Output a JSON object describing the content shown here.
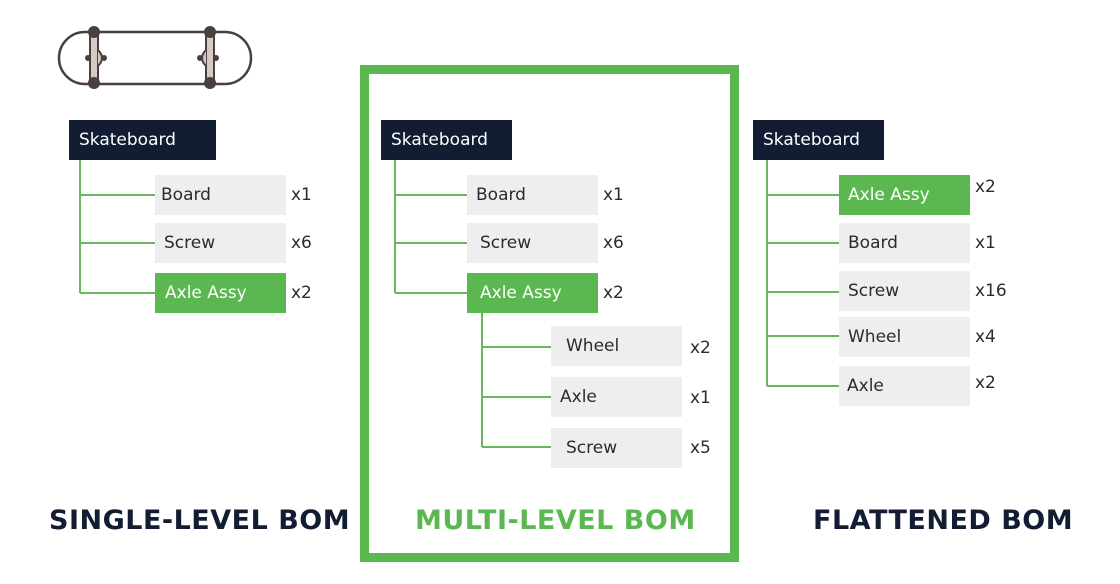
{
  "colors": {
    "root_bg": "#121d34",
    "item_bg": "#eeeef0",
    "highlight": "#5bb74f",
    "connector": "#6cb663",
    "title_dark": "#121d34",
    "frame": "#5bb74f"
  },
  "illustration": {
    "icon": "skateboard-icon"
  },
  "panels": [
    {
      "title": "SINGLE-LEVEL BOM",
      "root": "Skateboard",
      "items": [
        {
          "label": "Board",
          "qty": "x1",
          "highlight": false
        },
        {
          "label": "Screw",
          "qty": "x6",
          "highlight": false
        },
        {
          "label": "Axle Assy",
          "qty": "x2",
          "highlight": true
        }
      ]
    },
    {
      "title": "MULTI-LEVEL BOM",
      "selected": true,
      "root": "Skateboard",
      "items": [
        {
          "label": "Board",
          "qty": "x1",
          "highlight": false
        },
        {
          "label": "Screw",
          "qty": "x6",
          "highlight": false
        },
        {
          "label": "Axle Assy",
          "qty": "x2",
          "highlight": true,
          "children": [
            {
              "label": "Wheel",
              "qty": "x2"
            },
            {
              "label": "Axle",
              "qty": "x1"
            },
            {
              "label": "Screw",
              "qty": "x5"
            }
          ]
        }
      ]
    },
    {
      "title": "FLATTENED BOM",
      "root": "Skateboard",
      "items": [
        {
          "label": "Axle Assy",
          "qty": "x2",
          "highlight": true
        },
        {
          "label": "Board",
          "qty": "x1",
          "highlight": false
        },
        {
          "label": "Screw",
          "qty": "x16",
          "highlight": false
        },
        {
          "label": "Wheel",
          "qty": "x4",
          "highlight": false
        },
        {
          "label": "Axle",
          "qty": "x2",
          "highlight": false
        }
      ]
    }
  ]
}
